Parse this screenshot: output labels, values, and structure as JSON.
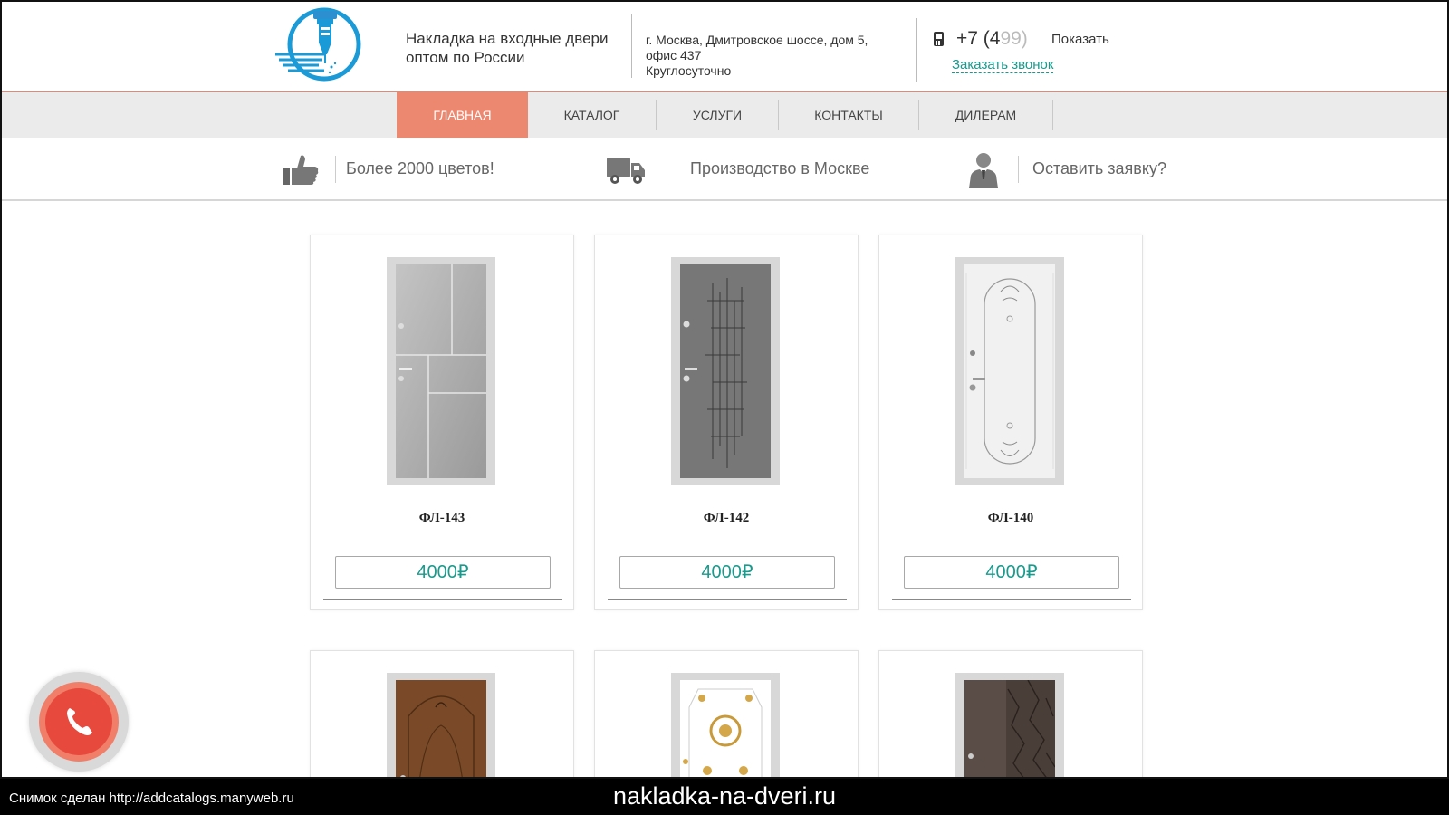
{
  "header": {
    "tagline": "Накладка на входные двери оптом по России",
    "address_line1": "г. Москва, Дмитровское шоссе, дом 5,",
    "address_line2": "офис 437",
    "hours": "Круглосуточно",
    "phone_prefix": "+7 (4",
    "phone_hidden": "99)",
    "show_label": "Показать",
    "callback_label": "Заказать звонок"
  },
  "nav": {
    "items": [
      {
        "label": "ГЛАВНАЯ",
        "active": true
      },
      {
        "label": "КАТАЛОГ"
      },
      {
        "label": "УСЛУГИ"
      },
      {
        "label": "КОНТАКТЫ"
      },
      {
        "label": "ДИЛЕРАМ"
      }
    ]
  },
  "features": [
    {
      "icon": "thumbs-up-icon",
      "text": "Более 2000 цветов!"
    },
    {
      "icon": "truck-icon",
      "text": "Производство в Москве"
    },
    {
      "icon": "manager-icon",
      "text": "Оставить заявку?"
    }
  ],
  "products": [
    {
      "title": "ФЛ-143",
      "price": "4000₽"
    },
    {
      "title": "ФЛ-142",
      "price": "4000₽"
    },
    {
      "title": "ФЛ-140",
      "price": "4000₽"
    }
  ],
  "footer": {
    "snapshot_text": "Снимок сделан http://addcatalogs.manyweb.ru",
    "domain": "nakladka-na-dveri.ru"
  },
  "colors": {
    "accent": "#ec8870",
    "link": "#1a9a8c",
    "call_button": "#e8493d"
  }
}
